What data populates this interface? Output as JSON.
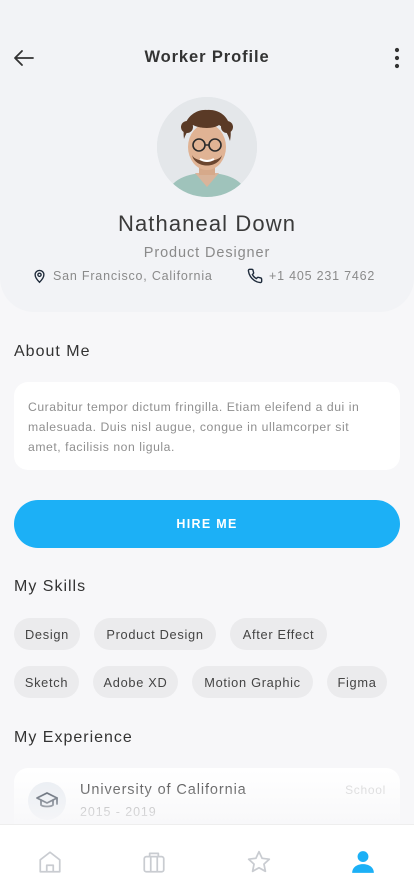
{
  "header": {
    "title": "Worker Profile"
  },
  "profile": {
    "name": "Nathaneal Down",
    "role": "Product Designer",
    "location": "San Francisco, California",
    "phone": "+1 405 231 7462"
  },
  "about": {
    "title": "About Me",
    "text": "Curabitur tempor dictum fringilla. Etiam eleifend a dui in malesuada. Duis nisl augue, congue in ullamcorper sit amet, facilisis non ligula."
  },
  "hire_button": "HIRE ME",
  "skills": {
    "title": "My Skills",
    "items": [
      "Design",
      "Product Design",
      "After Effect",
      "Sketch",
      "Adobe XD",
      "Motion Graphic",
      "Figma"
    ]
  },
  "experience": {
    "title": "My Experience",
    "items": [
      {
        "title": "University of California",
        "years": "2015 - 2019",
        "type": "School"
      }
    ]
  },
  "nav": {
    "items": [
      "home-icon",
      "briefcase-icon",
      "star-icon",
      "profile-icon"
    ],
    "active_index": 3
  },
  "colors": {
    "accent": "#1cb0f6",
    "icon_inactive": "#c9ccd1",
    "background": "#f7f7f9"
  }
}
